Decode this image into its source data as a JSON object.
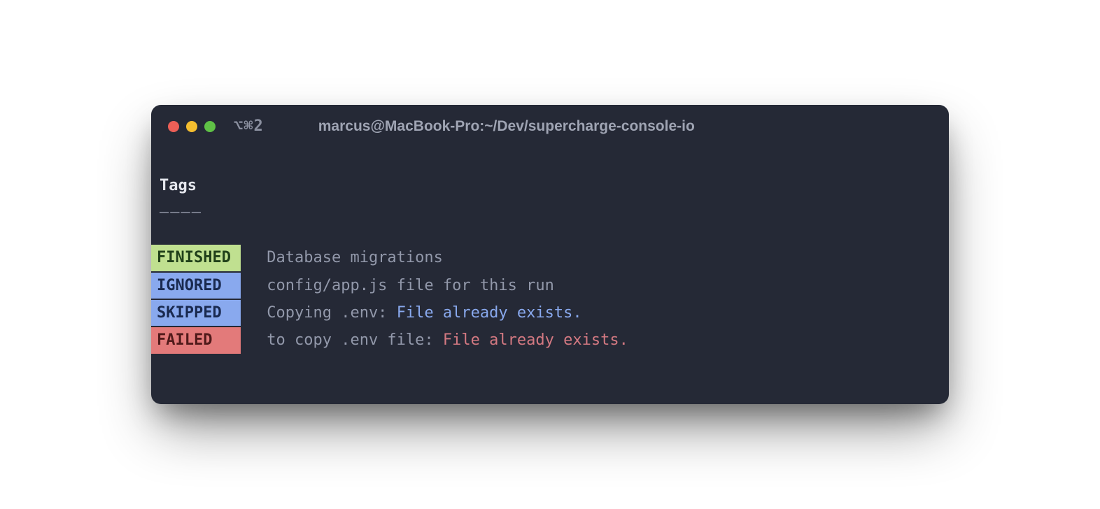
{
  "window": {
    "tab_indicator": "⌥⌘2",
    "title": "marcus@MacBook-Pro:~/Dev/supercharge-console-io"
  },
  "section": {
    "heading": "Tags",
    "underline": "————"
  },
  "lines": [
    {
      "tag": "FINISHED",
      "tag_class": "tag-finished",
      "msg_pre": " Database migrations",
      "msg_hl": "",
      "hl_class": ""
    },
    {
      "tag": "IGNORED",
      "tag_class": "tag-ignored",
      "msg_pre": " config/app.js file for this run",
      "msg_hl": "",
      "hl_class": ""
    },
    {
      "tag": "SKIPPED",
      "tag_class": "tag-skipped",
      "msg_pre": " Copying .env: ",
      "msg_hl": "File already exists.",
      "hl_class": "msg-highlight-blue"
    },
    {
      "tag": "FAILED",
      "tag_class": "tag-failed",
      "msg_pre": " to copy .env file: ",
      "msg_hl": "File already exists.",
      "hl_class": "msg-highlight-red"
    }
  ]
}
